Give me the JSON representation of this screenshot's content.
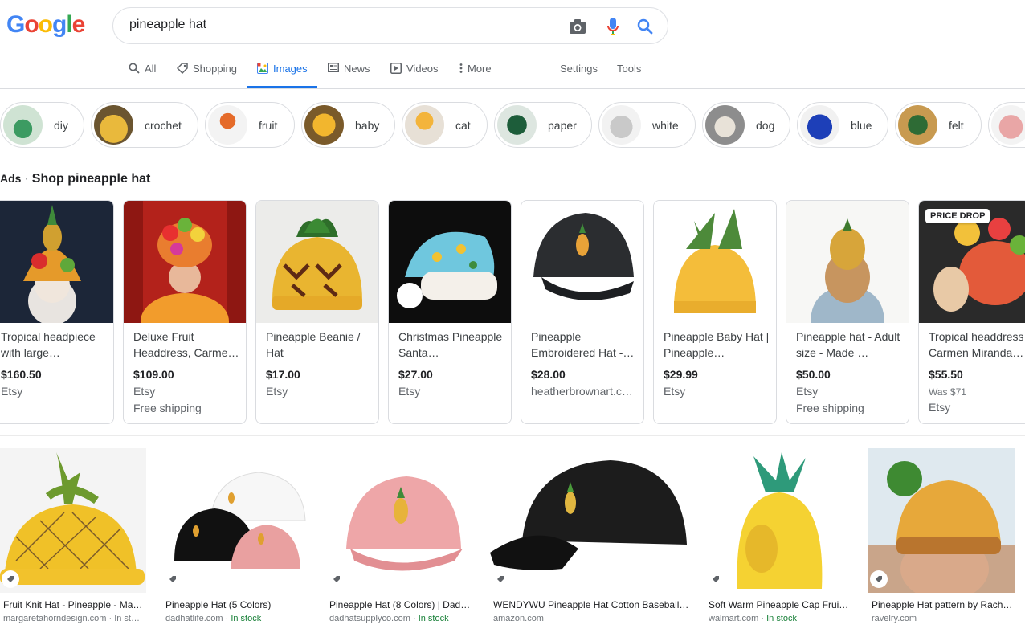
{
  "logo": [
    "G",
    "o",
    "o",
    "g",
    "l",
    "e"
  ],
  "search": {
    "query": "pineapple hat",
    "camera_icon": "camera-icon",
    "mic_icon": "mic-icon",
    "search_icon": "search-icon"
  },
  "tabs": {
    "all": "All",
    "shopping": "Shopping",
    "images": "Images",
    "news": "News",
    "videos": "Videos",
    "more": "More",
    "settings": "Settings",
    "tools": "Tools"
  },
  "chips": [
    "diy",
    "crochet",
    "fruit",
    "baby",
    "cat",
    "paper",
    "white",
    "dog",
    "blue",
    "felt"
  ],
  "ads_header": {
    "ads": "Ads",
    "sep": "·",
    "shop": "Shop pineapple hat"
  },
  "ads": [
    {
      "title": "Tropical headpiece with large…",
      "price": "$160.50",
      "store": "Etsy"
    },
    {
      "title": "Deluxe Fruit Headdress, Carme…",
      "price": "$109.00",
      "store": "Etsy",
      "shipping": "Free shipping"
    },
    {
      "title": "Pineapple Beanie / Hat",
      "price": "$17.00",
      "store": "Etsy"
    },
    {
      "title": "Christmas Pineapple Santa…",
      "price": "$27.00",
      "store": "Etsy"
    },
    {
      "title": "Pineapple Embroidered Hat -…",
      "price": "$28.00",
      "store": "heatherbrownart.c…"
    },
    {
      "title": "Pineapple Baby Hat | Pineapple…",
      "price": "$29.99",
      "store": "Etsy"
    },
    {
      "title": "Pineapple hat - Adult size - Made …",
      "price": "$50.00",
      "store": "Etsy",
      "shipping": "Free shipping"
    },
    {
      "title": "Tropical headdress Carmen Miranda…",
      "price": "$55.50",
      "was": "Was $71",
      "store": "Etsy",
      "badge": "PRICE DROP"
    }
  ],
  "results": [
    {
      "title": "Fruit Knit Hat - Pineapple - Ma…",
      "source": "margaretahorndesign.com",
      "stock": "In st…"
    },
    {
      "title": "Pineapple Hat (5 Colors)",
      "source": "dadhatlife.com",
      "stock": "In stock"
    },
    {
      "title": "Pineapple Hat (8 Colors) | Dad…",
      "source": "dadhatsupplyco.com",
      "stock": "In stock"
    },
    {
      "title": "WENDYWU Pineapple Hat Cotton Baseball…",
      "source": "amazon.com",
      "stock": ""
    },
    {
      "title": "Soft Warm Pineapple Cap Frui…",
      "source": "walmart.com",
      "stock": "In stock"
    },
    {
      "title": "Pineapple Hat pattern by Rach…",
      "source": "ravelry.com",
      "stock": ""
    }
  ],
  "colors": {
    "accent": "#1a73e8",
    "stock": "#188038"
  }
}
